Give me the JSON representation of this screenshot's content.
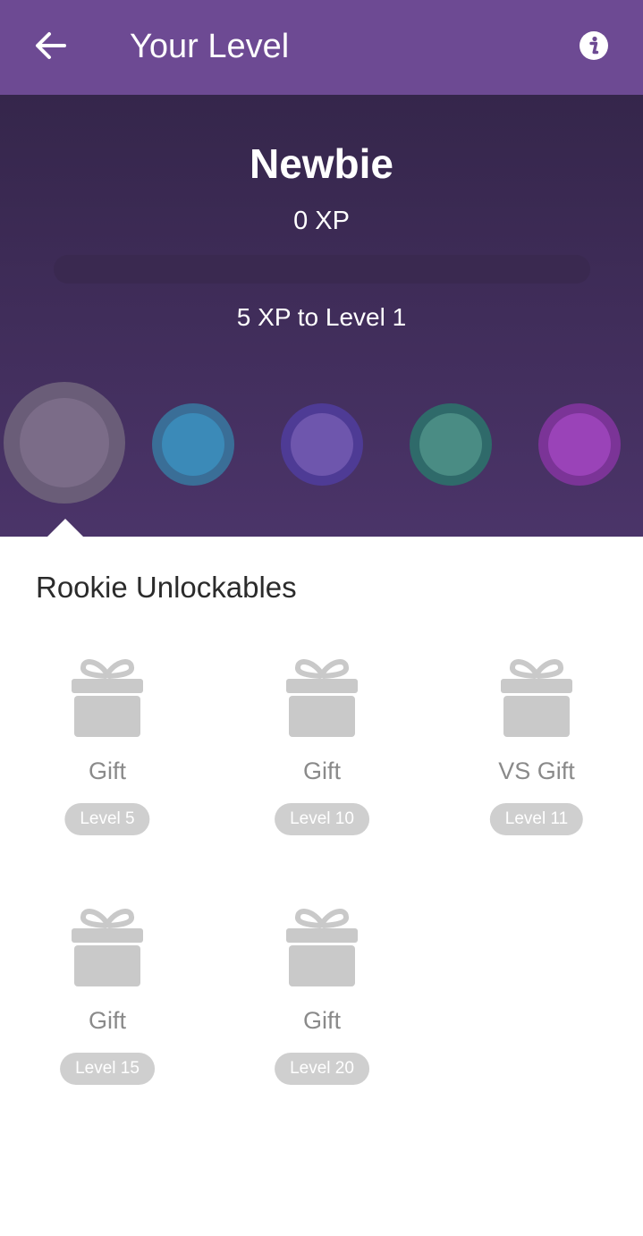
{
  "header": {
    "title": "Your Level"
  },
  "level": {
    "name": "Newbie",
    "xp_text": "0 XP",
    "progress": 0,
    "next_text": "5 XP to Level 1"
  },
  "level_dots": [
    {
      "ring": "#6a5d78",
      "fill": "#7b6c88",
      "selected": true
    },
    {
      "ring": "#3a6e97",
      "fill": "#3b8ab8"
    },
    {
      "ring": "#4e3b95",
      "fill": "#6e56ad"
    },
    {
      "ring": "#2f6a6a",
      "fill": "#4a8c84"
    },
    {
      "ring": "#7b3497",
      "fill": "#9a43b8"
    }
  ],
  "unlockables": {
    "title": "Rookie Unlockables",
    "items": [
      {
        "icon": "gift-icon",
        "name": "Gift",
        "level": "Level 5"
      },
      {
        "icon": "gift-icon",
        "name": "Gift",
        "level": "Level 10"
      },
      {
        "icon": "gift-icon",
        "name": "VS Gift",
        "level": "Level 11"
      },
      {
        "icon": "gift-icon",
        "name": "Gift",
        "level": "Level 15"
      },
      {
        "icon": "gift-icon",
        "name": "Gift",
        "level": "Level 20"
      }
    ]
  },
  "colors": {
    "appbar": "#6d4a93",
    "hero_top": "#35264b",
    "hero_bottom": "#4b3469",
    "gift_gray": "#c9c9c9",
    "badge_gray": "#cfcfcf"
  }
}
